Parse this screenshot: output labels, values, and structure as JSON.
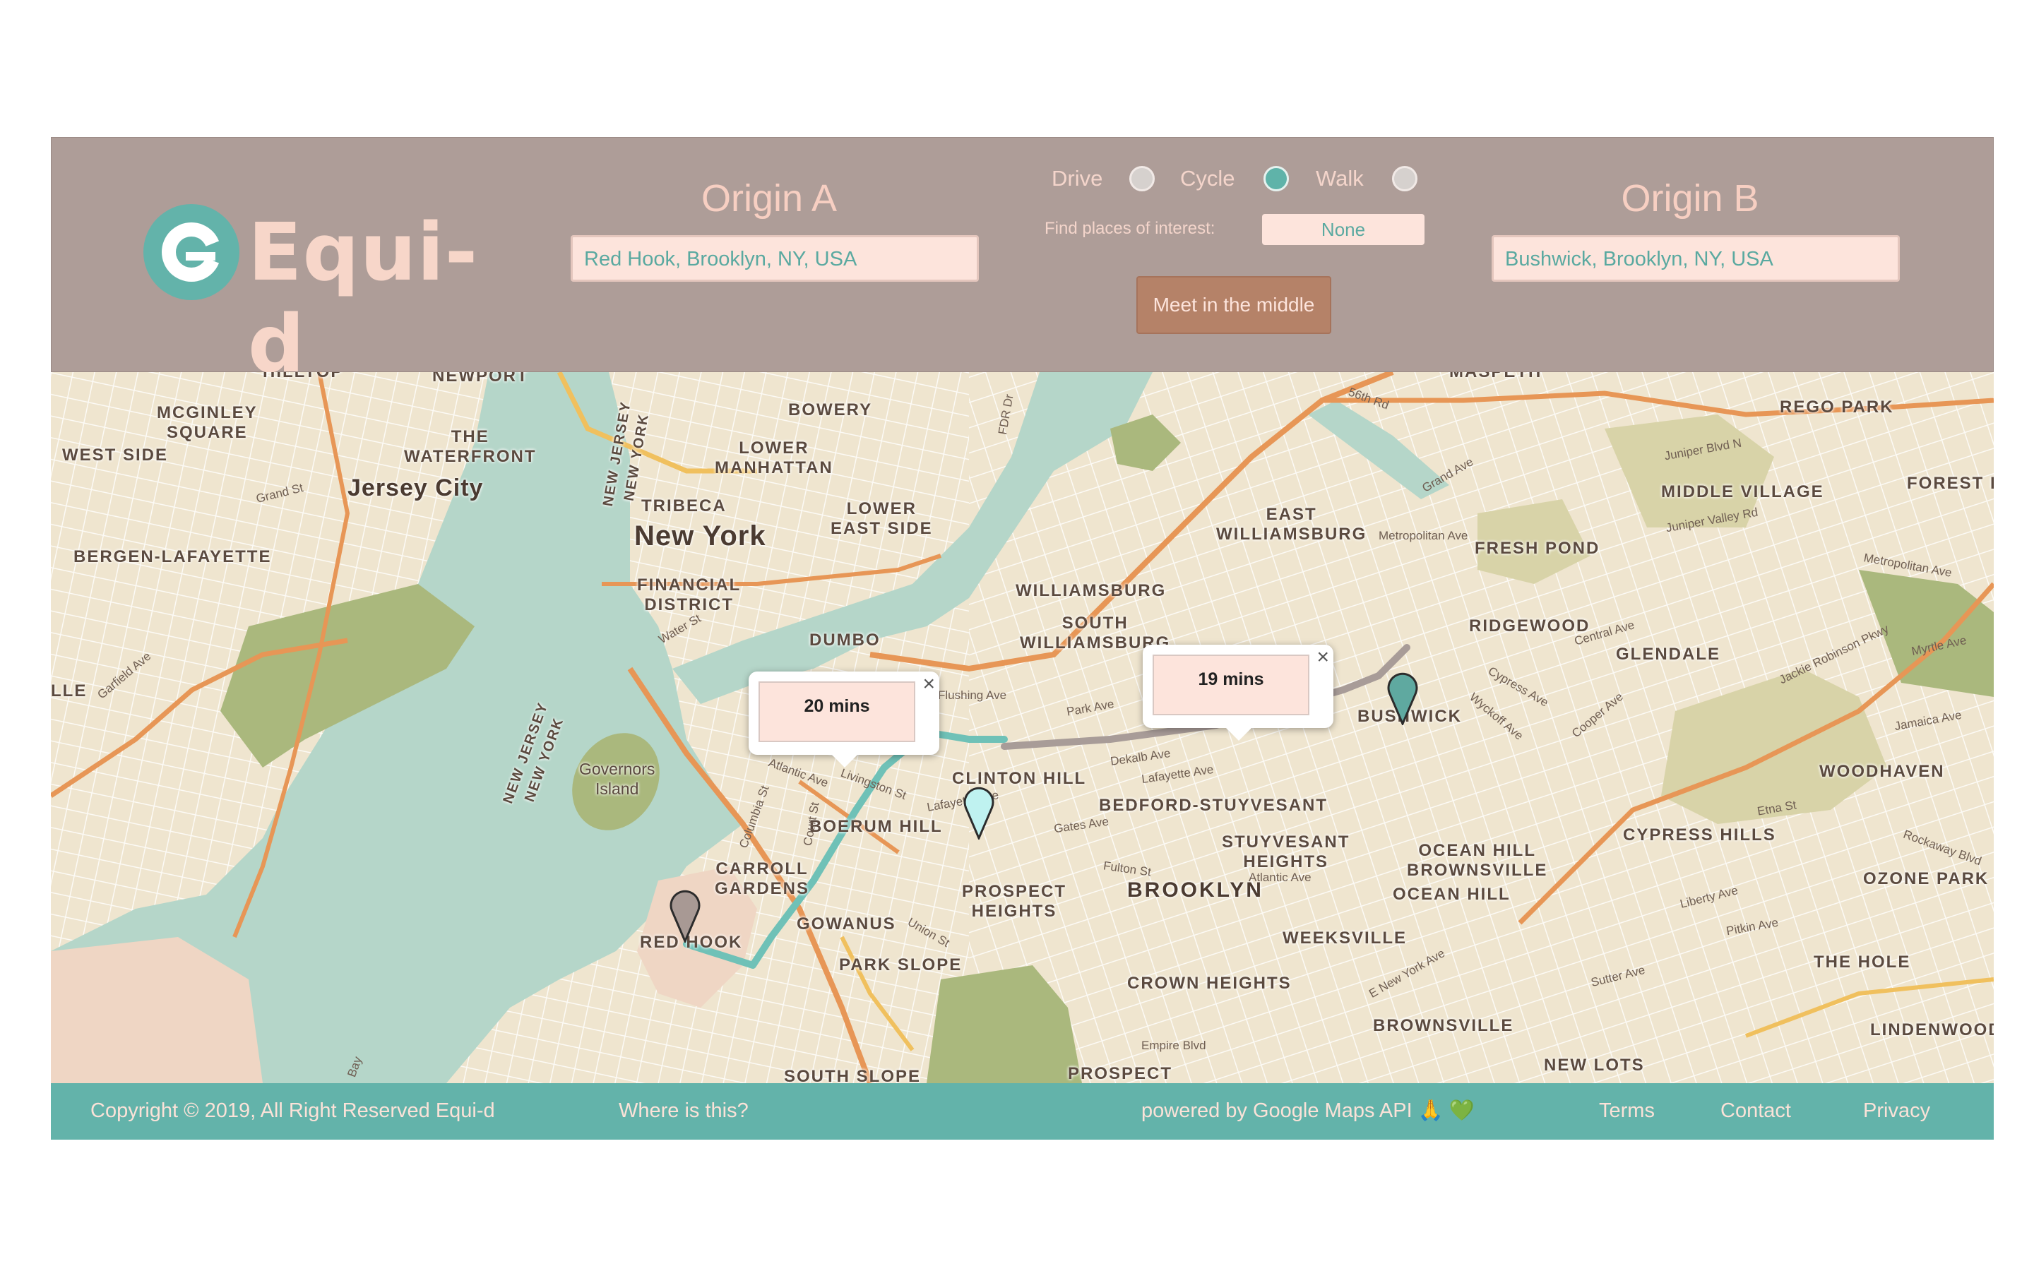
{
  "app": {
    "name": "Equi-d"
  },
  "header": {
    "origin_a": {
      "title": "Origin A",
      "value": "Red Hook, Brooklyn, NY, USA"
    },
    "origin_b": {
      "title": "Origin B",
      "value": "Bushwick, Brooklyn, NY, USA"
    },
    "modes": [
      {
        "label": "Drive",
        "selected": false
      },
      {
        "label": "Cycle",
        "selected": true
      },
      {
        "label": "Walk",
        "selected": false
      }
    ],
    "poi_label": "Find places of interest:",
    "poi_value": "None",
    "meet_button": "Meet in the middle"
  },
  "map": {
    "popups": [
      {
        "text": "20 mins",
        "close": "×"
      },
      {
        "text": "19 mins",
        "close": "×"
      }
    ],
    "labels": {
      "newport": "NEWPORT",
      "hudson": "HILLTOP",
      "mcginley": "MCGINLEY\nSQUARE",
      "westside": "WEST SIDE",
      "waterfront": "THE\nWATERFRONT",
      "jerseycity": "Jersey City",
      "bergen": "BERGEN-LAFAYETTE",
      "lle": "LLE",
      "njny1": "NEW JERSEY\nNEW YORK",
      "njny2": "NEW JERSEY\nNEW YORK",
      "bowery": "BOWERY",
      "lowerman": "LOWER\nMANHATTAN",
      "tribeca": "TRIBECA",
      "lowereast": "LOWER\nEAST SIDE",
      "newyork": "New York",
      "financial": "FINANCIAL\nDISTRICT",
      "dumbo": "DUMBO",
      "williamsburg": "WILLIAMSBURG",
      "southw": "SOUTH\nWILLIAMSBURG",
      "eastw": "EAST\nWILLIAMSBURG",
      "maspeth": "MASPETH",
      "regopark": "REGO PARK",
      "middlevillage": "MIDDLE VILLAGE",
      "foresth": "FOREST H",
      "freshpond": "FRESH POND",
      "ridgewood": "RIDGEWOOD",
      "glendale": "GLENDALE",
      "bushwick": "BUSHWICK",
      "clintonhill": "CLINTON HILL",
      "governors": "Governors\nIsland",
      "boerum": "BOERUM HILL",
      "carroll": "CARROLL\nGARDENS",
      "redhook": "RED HOOK",
      "gowanus": "GOWANUS",
      "parkslope": "PARK SLOPE",
      "prospecth": "PROSPECT\nHEIGHTS",
      "bedstuy": "BEDFORD-STUYVESANT",
      "stuyvesant": "STUYVESANT\nHEIGHTS",
      "brooklyn": "BROOKLYN",
      "oceanhillb": "OCEAN HILL\nBROWNSVILLE",
      "oceanhill": "OCEAN HILL",
      "weeksville": "WEEKSVILLE",
      "crownheights": "CROWN HEIGHTS",
      "brownsville": "BROWNSVILLE",
      "newlots": "NEW LOTS",
      "cypress": "CYPRESS HILLS",
      "woodhaven": "WOODHAVEN",
      "ozone": "OZONE PARK",
      "thehole": "THE HOLE",
      "lindenwood": "LINDENWOOD",
      "southslope": "SOUTH SLOPE",
      "prospect": "PROSPECT"
    },
    "streets": {
      "grandst": "Grand St",
      "garfield": "Garfield Ave",
      "waterst": "Water St",
      "flushing": "Flushing Ave",
      "parkave": "Park Ave",
      "dekalb": "Dekalb Ave",
      "lafayette": "Lafayette Ave",
      "lafayette2": "Lafayette Ave",
      "gates": "Gates Ave",
      "fulton": "Fulton St",
      "atlantic": "Atlantic Ave",
      "atlantic2": "Atlantic Ave",
      "livingston": "Livingston St",
      "columbia": "Columbia St",
      "courtst": "Court St",
      "unionst": "Union St",
      "pitkin": "Pitkin Ave",
      "sutter": "Sutter Ave",
      "liberty": "Liberty Ave",
      "empire": "Empire Blvd",
      "metro": "Metropolitan Ave",
      "metro2": "Metropolitan Ave",
      "grandave": "Grand Ave",
      "juniper": "Juniper Blvd N",
      "juniper2": "Juniper Valley Rd",
      "myrtle": "Myrtle Ave",
      "jackie": "Jackie Robinson Pkwy",
      "cypressave": "Cypress Ave",
      "wyckoff": "Wyckoff Ave",
      "central": "Central Ave",
      "cooper": "Cooper Ave",
      "jamaica": "Jamaica Ave",
      "etna": "Etna St",
      "rockaway": "Rockaway Blvd",
      "fdr": "FDR Dr",
      "eastny": "E New York Ave",
      "bay": "Bay",
      "fifty6": "56th Rd"
    }
  },
  "footer": {
    "copyright": "Copyright © 2019, All Right Reserved Equi-d",
    "where": "Where is this?",
    "powered": "powered by Google Maps API 🙏 💚",
    "terms": "Terms",
    "contact": "Contact",
    "privacy": "Privacy"
  },
  "colors": {
    "header_bg": "#ae9d98",
    "accent_teal": "#63b3aa",
    "title_peach": "#f7cfc2",
    "field_bg": "#fde4dc",
    "button_brown": "#b58268",
    "map_land": "#efe5cf",
    "map_water": "#b5d6c9",
    "map_park": "#aab87d",
    "highway_orange": "#e79656"
  }
}
